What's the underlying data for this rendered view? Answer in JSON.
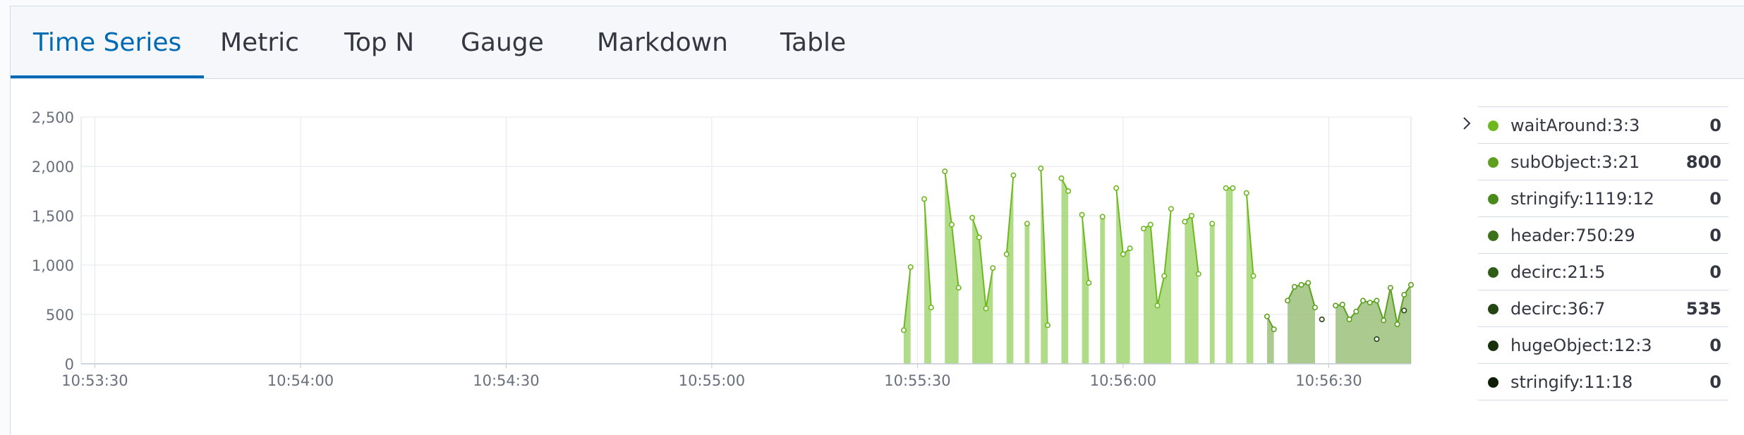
{
  "tabs": [
    {
      "label": "Time Series",
      "active": true
    },
    {
      "label": "Metric",
      "active": false
    },
    {
      "label": "Top N",
      "active": false
    },
    {
      "label": "Gauge",
      "active": false
    },
    {
      "label": "Markdown",
      "active": false
    },
    {
      "label": "Table",
      "active": false
    }
  ],
  "legend": {
    "toggle_icon": "chevron-right-icon",
    "items": [
      {
        "label": "waitAround:3:3",
        "value": "0",
        "color": "#6eb81f"
      },
      {
        "label": "subObject:3:21",
        "value": "800",
        "color": "#5ca01e"
      },
      {
        "label": "stringify:1119:12",
        "value": "0",
        "color": "#4a8a1c"
      },
      {
        "label": "header:750:29",
        "value": "0",
        "color": "#3c7219"
      },
      {
        "label": "decirc:21:5",
        "value": "0",
        "color": "#2f5c16"
      },
      {
        "label": "decirc:36:7",
        "value": "535",
        "color": "#234511"
      },
      {
        "label": "hugeObject:12:3",
        "value": "0",
        "color": "#18300c"
      },
      {
        "label": "stringify:11:18",
        "value": "0",
        "color": "#0f1f07"
      }
    ]
  },
  "chart_data": {
    "type": "area",
    "title": "",
    "xlabel": "",
    "ylabel": "",
    "x_ticks": [
      "10:53:30",
      "10:54:00",
      "10:54:30",
      "10:55:00",
      "10:55:30",
      "10:56:00",
      "10:56:30"
    ],
    "x_range": [
      "10:53:28",
      "10:56:42"
    ],
    "ylim": [
      0,
      2500
    ],
    "y_ticks": [
      "0",
      "500",
      "1,000",
      "1,500",
      "2,000",
      "2,500"
    ],
    "y_tick_values": [
      0,
      500,
      1000,
      1500,
      2000,
      2500
    ],
    "grid": true,
    "legend_position": "right",
    "series": [
      {
        "name": "waitAround:3:3",
        "color": "#6eb81f",
        "points": [
          [
            "10:55:28",
            340
          ],
          [
            "10:55:29",
            980
          ],
          [
            "10:55:31",
            1670
          ],
          [
            "10:55:32",
            570
          ],
          [
            "10:55:34",
            1950
          ],
          [
            "10:55:35",
            1410
          ],
          [
            "10:55:36",
            770
          ],
          [
            "10:55:38",
            1480
          ],
          [
            "10:55:39",
            1280
          ],
          [
            "10:55:40",
            560
          ],
          [
            "10:55:41",
            970
          ],
          [
            "10:55:43",
            1110
          ],
          [
            "10:55:44",
            1910
          ],
          [
            "10:55:46",
            1420
          ],
          [
            "10:55:48",
            1980
          ],
          [
            "10:55:49",
            390
          ],
          [
            "10:55:51",
            1880
          ],
          [
            "10:55:52",
            1750
          ],
          [
            "10:55:54",
            1510
          ],
          [
            "10:55:55",
            820
          ],
          [
            "10:55:57",
            1490
          ],
          [
            "10:55:59",
            1780
          ],
          [
            "10:56:00",
            1110
          ],
          [
            "10:56:01",
            1170
          ],
          [
            "10:56:03",
            1370
          ],
          [
            "10:56:04",
            1410
          ],
          [
            "10:56:05",
            590
          ],
          [
            "10:56:06",
            890
          ],
          [
            "10:56:07",
            1570
          ],
          [
            "10:56:09",
            1440
          ],
          [
            "10:56:10",
            1500
          ],
          [
            "10:56:11",
            910
          ],
          [
            "10:56:13",
            1420
          ],
          [
            "10:56:15",
            1780
          ],
          [
            "10:56:16",
            1780
          ],
          [
            "10:56:18",
            1730
          ],
          [
            "10:56:19",
            890
          ]
        ]
      },
      {
        "name": "subObject:3:21",
        "color": "#5ca01e",
        "points": [
          [
            "10:56:21",
            480
          ],
          [
            "10:56:22",
            350
          ],
          [
            "10:56:24",
            640
          ],
          [
            "10:56:25",
            780
          ],
          [
            "10:56:26",
            800
          ],
          [
            "10:56:27",
            820
          ],
          [
            "10:56:28",
            570
          ],
          [
            "10:56:31",
            590
          ],
          [
            "10:56:32",
            600
          ],
          [
            "10:56:33",
            450
          ],
          [
            "10:56:34",
            530
          ],
          [
            "10:56:35",
            640
          ],
          [
            "10:56:36",
            620
          ],
          [
            "10:56:37",
            640
          ],
          [
            "10:56:38",
            440
          ],
          [
            "10:56:39",
            770
          ],
          [
            "10:56:40",
            400
          ],
          [
            "10:56:41",
            700
          ],
          [
            "10:56:42",
            800
          ]
        ]
      },
      {
        "name": "decirc:36:7",
        "color": "#234511",
        "points": [
          [
            "10:56:29",
            450
          ],
          [
            "10:56:37",
            250
          ],
          [
            "10:56:41",
            540
          ]
        ]
      }
    ]
  }
}
